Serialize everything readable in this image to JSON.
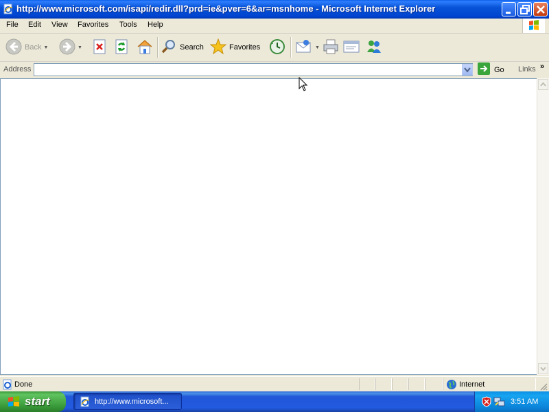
{
  "window": {
    "title": "http://www.microsoft.com/isapi/redir.dll?prd=ie&pver=6&ar=msnhome - Microsoft Internet Explorer"
  },
  "menu": [
    "File",
    "Edit",
    "View",
    "Favorites",
    "Tools",
    "Help"
  ],
  "toolbar": {
    "back_label": "Back",
    "search_label": "Search",
    "favorites_label": "Favorites"
  },
  "address": {
    "label": "Address",
    "value": "",
    "go_label": "Go",
    "links_label": "Links"
  },
  "status": {
    "text": "Done",
    "zone": "Internet"
  },
  "taskbar": {
    "start_label": "start",
    "task_label": "http://www.microsoft...",
    "clock": "3:51 AM"
  },
  "colors": {
    "titlebar": "#0a5ee8",
    "taskbar": "#225ae0",
    "start_button": "#3c9a3c"
  }
}
